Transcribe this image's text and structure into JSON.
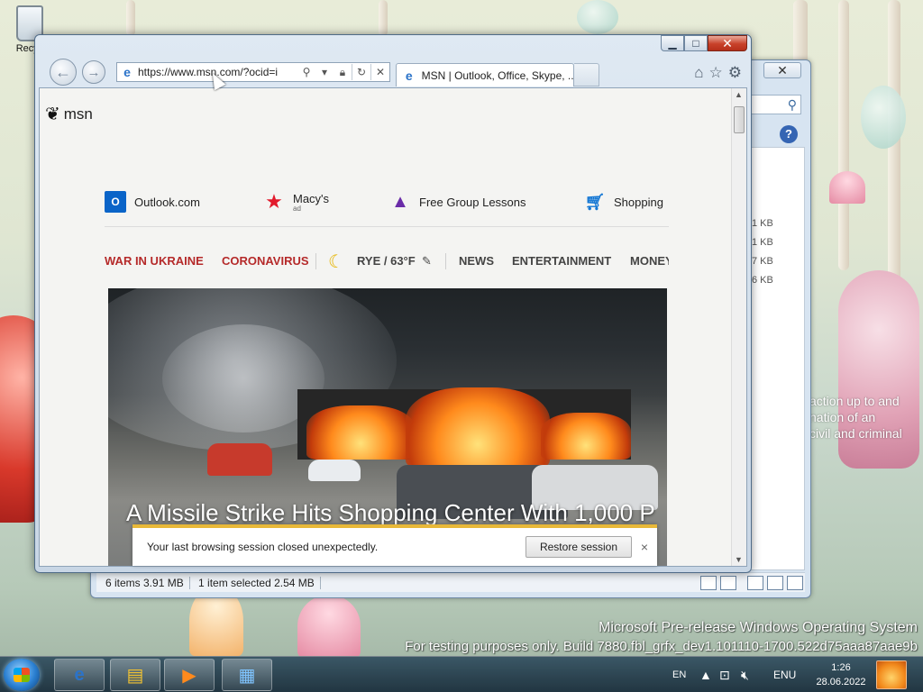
{
  "desktop": {
    "recycle_bin_label": "Recyc",
    "watermark": {
      "line1": "Microsoft Pre-release Windows Operating System",
      "line2": "For testing purposes only. Build 7880.fbl_grfx_dev1.101110-1700.522d75aaa87aae9b"
    },
    "bg_text": [
      "action up to and",
      "nation of an",
      "civil and criminal"
    ]
  },
  "explorer": {
    "close_label": "✕",
    "search_icon": "search-icon",
    "sizes": [
      "1 KB",
      "1 KB",
      "7 KB",
      "6 KB"
    ],
    "status": {
      "items": "6 items  3.91 MB",
      "selected": "1 item selected  2.54 MB"
    }
  },
  "browser": {
    "address": "https://www.msn.com/?ocid=i",
    "tab_title": "MSN | Outlook, Office, Skype, ...",
    "back_glyph": "←",
    "forward_glyph": "→",
    "minimize_glyph": "▁",
    "maximize_glyph": "□",
    "close_glyph": "✕",
    "toolbar_icons": {
      "home": "⌂",
      "favorites": "☆",
      "tools": "⚙"
    }
  },
  "page": {
    "logo_text": "msn",
    "quicklinks": [
      {
        "label": "Outlook.com",
        "icon": "outlook-icon"
      },
      {
        "label": "Macy's",
        "sublabel": "ad",
        "icon": "macys-star-icon"
      },
      {
        "label": "Free Group Lessons",
        "icon": "graduation-cap-icon"
      },
      {
        "label": "Shopping",
        "icon": "shopping-cart-icon"
      }
    ],
    "nav": {
      "war": "WAR IN UKRAINE",
      "coronavirus": "CORONAVIRUS",
      "weather": "RYE / 63°F",
      "news": "NEWS",
      "entertainment": "ENTERTAINMENT",
      "money": "MONEY"
    },
    "hero_headline": "A Missile Strike Hits Shopping Center With 1,000 P",
    "restore_bar": {
      "message": "Your last browsing session closed unexpectedly.",
      "button": "Restore session",
      "close": "×"
    }
  },
  "taskbar": {
    "language": "EN",
    "lang_indicator": "ENU",
    "time": "1:26",
    "date": "28.06.2022"
  },
  "colors": {
    "nav_red": "#b52a2a",
    "ie_blue": "#2b73c9",
    "restore_bar_accent": "#e8b838"
  }
}
